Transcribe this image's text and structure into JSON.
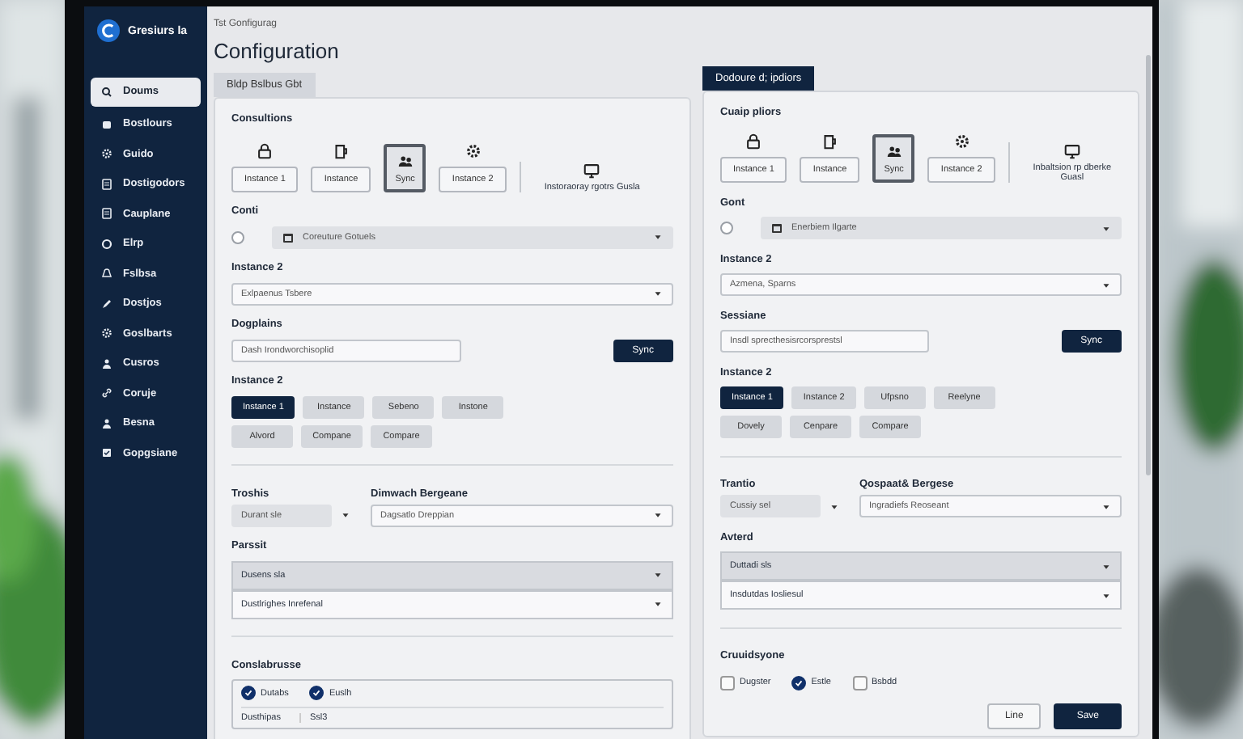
{
  "sidebar": {
    "brand": "Gresiurs la",
    "items": [
      {
        "label": "Doums",
        "selected": true
      },
      {
        "label": "Bostlours",
        "selected": false
      },
      {
        "label": "Guido",
        "selected": false
      },
      {
        "label": "Dostigodors",
        "selected": false
      },
      {
        "label": "Cauplane",
        "selected": false
      },
      {
        "label": "Elrp",
        "selected": false
      },
      {
        "label": "Fslbsa",
        "selected": false
      },
      {
        "label": "Dostjos",
        "selected": false
      },
      {
        "label": "Goslbarts",
        "selected": false
      },
      {
        "label": "Cusros",
        "selected": false
      },
      {
        "label": "Coruje",
        "selected": false
      },
      {
        "label": "Besna",
        "selected": false
      },
      {
        "label": "Gopgsiane",
        "selected": false
      }
    ]
  },
  "breadcrumb": "Tst Gonfigurag",
  "title": "Configuration",
  "panels": [
    {
      "tab": {
        "label": "Bldp Bslbus  Gbt",
        "selected": false
      },
      "heading": "Consultions",
      "options": [
        {
          "kind": "button",
          "label": "Instance 1",
          "selected": false
        },
        {
          "kind": "button",
          "label": "Instance",
          "selected": false
        },
        {
          "kind": "button",
          "label": "Sync",
          "selected": true
        },
        {
          "kind": "button",
          "label": "Instance 2",
          "selected": false
        },
        {
          "kind": "note",
          "label": "Instoraoray rgotrs Gusla"
        }
      ],
      "conti": {
        "label": "Conti",
        "checked": false,
        "value": "Coreuture Gotuels"
      },
      "select": {
        "label": "Instance 2",
        "value": "Exlpaenus Tsbere"
      },
      "input": {
        "label": "Dogplains",
        "value": "Dash Irondworchisoplid",
        "button": "Sync"
      },
      "chips": {
        "label": "Instance 2",
        "rows": [
          {
            "items": [
              {
                "label": "Instance 1",
                "selected": true
              },
              {
                "label": "Instance",
                "selected": false
              },
              {
                "label": "Sebeno",
                "selected": false
              },
              {
                "label": "Instone",
                "selected": false
              }
            ]
          },
          {
            "items": [
              {
                "label": "Alvord",
                "selected": false
              },
              {
                "label": "Compane",
                "selected": false
              },
              {
                "label": "Compare",
                "selected": false
              }
            ]
          }
        ]
      },
      "split": {
        "label_1": "Troshis",
        "value_1": "Durant sle",
        "label_2": "Dimwach Bergeane",
        "value_2": "Dagsatlo Dreppian"
      },
      "stacked": {
        "label": "Parssit",
        "options": [
          {
            "label": "Dusens sla",
            "selected": true
          },
          {
            "label": "Dustlrighes Inrefenal",
            "selected": false
          }
        ]
      },
      "checks": {
        "label": "Conslabrusse",
        "items": [
          {
            "label": "Dutabs",
            "checked": true
          },
          {
            "label": "Euslh",
            "checked": true
          }
        ],
        "cells": [
          "Dusthipas",
          "Ssl3"
        ]
      }
    },
    {
      "tab": {
        "label": "Dodoure d; ipdiors",
        "selected": true
      },
      "heading": "Cuaip pliors",
      "options": [
        {
          "kind": "button",
          "label": "Instance 1",
          "selected": false
        },
        {
          "kind": "button",
          "label": "Instance",
          "selected": false
        },
        {
          "kind": "button",
          "label": "Sync",
          "selected": true
        },
        {
          "kind": "button",
          "label": "Instance 2",
          "selected": false
        },
        {
          "kind": "note",
          "label": "Inbaltsion rp dberke Guasl"
        }
      ],
      "conti": {
        "label": "Gont",
        "checked": false,
        "value": "Enerbiem Ilgarte"
      },
      "select": {
        "label": "Instance 2",
        "value": "Azmena, Sparns"
      },
      "input": {
        "label": "Sessiane",
        "value": "Insdl sprecthesisrcorsprestsl",
        "button": "Sync"
      },
      "chips": {
        "label": "Instance 2",
        "rows": [
          {
            "items": [
              {
                "label": "Instance 1",
                "selected": true
              },
              {
                "label": "Instance 2",
                "selected": false
              },
              {
                "label": "Ufpsno",
                "selected": false
              },
              {
                "label": "Reelyne",
                "selected": false
              }
            ]
          },
          {
            "items": [
              {
                "label": "Dovely",
                "selected": false
              },
              {
                "label": "Cenpare",
                "selected": false
              },
              {
                "label": "Compare",
                "selected": false
              }
            ]
          }
        ]
      },
      "split": {
        "label_1": "Trantio",
        "value_1": "Cussiy sel",
        "label_2": "Qospaat& Bergese",
        "value_2": "Ingradiefs Reoseant"
      },
      "stacked": {
        "label": "Avterd",
        "options": [
          {
            "label": "Duttadi sls",
            "selected": true
          },
          {
            "label": "Insdutdas Iosliesul",
            "selected": false
          }
        ]
      },
      "checks": {
        "label": "Cruuidsyone",
        "items": [
          {
            "label": "Dugster",
            "checked": false
          },
          {
            "label": "Estle",
            "checked": true
          },
          {
            "label": "Bsbdd",
            "checked": false
          }
        ]
      },
      "buttons": [
        {
          "label": "Line",
          "kind": "secondary"
        },
        {
          "label": "Save",
          "kind": "primary"
        }
      ]
    }
  ]
}
